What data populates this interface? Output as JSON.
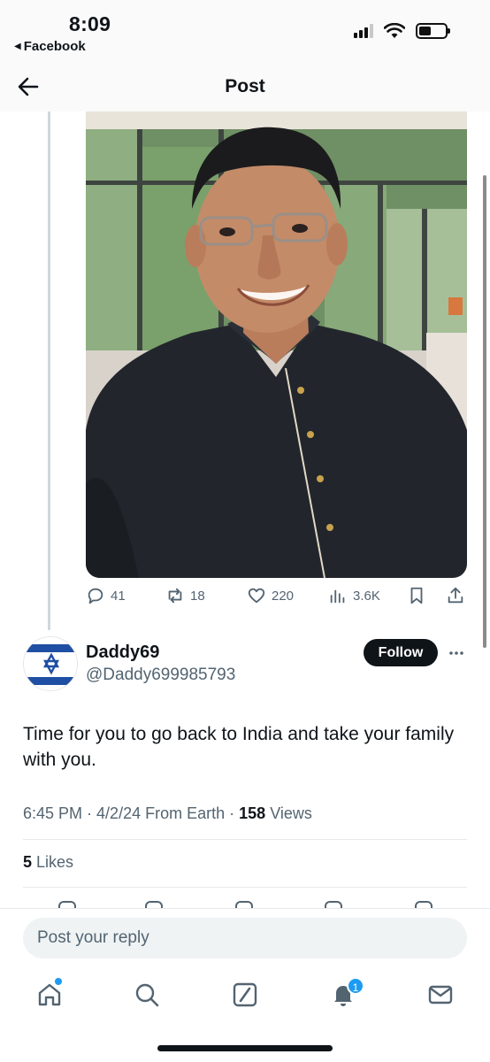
{
  "status_bar": {
    "time": "8:09",
    "back_app": "Facebook"
  },
  "header": {
    "title": "Post"
  },
  "media": {
    "description_icon": "photo"
  },
  "previous_post_actions": {
    "replies": "41",
    "reposts": "18",
    "likes": "220",
    "views": "3.6K"
  },
  "reply": {
    "author_name": "Daddy69",
    "author_handle": "@Daddy699985793",
    "follow_label": "Follow",
    "text": "Time for you to go back to India and take your family with you.",
    "time": "6:45 PM",
    "date": "4/2/24",
    "source": "From Earth",
    "views_count": "158",
    "views_label": "Views",
    "likes_count": "5",
    "likes_label": "Likes"
  },
  "composer": {
    "placeholder": "Post your reply"
  },
  "tab_bar": {
    "notification_badge": "1"
  },
  "colors": {
    "accent": "#1d9bf0",
    "text_primary": "#0f1419",
    "text_secondary": "#536471",
    "flag_blue": "#1f4fa3"
  }
}
